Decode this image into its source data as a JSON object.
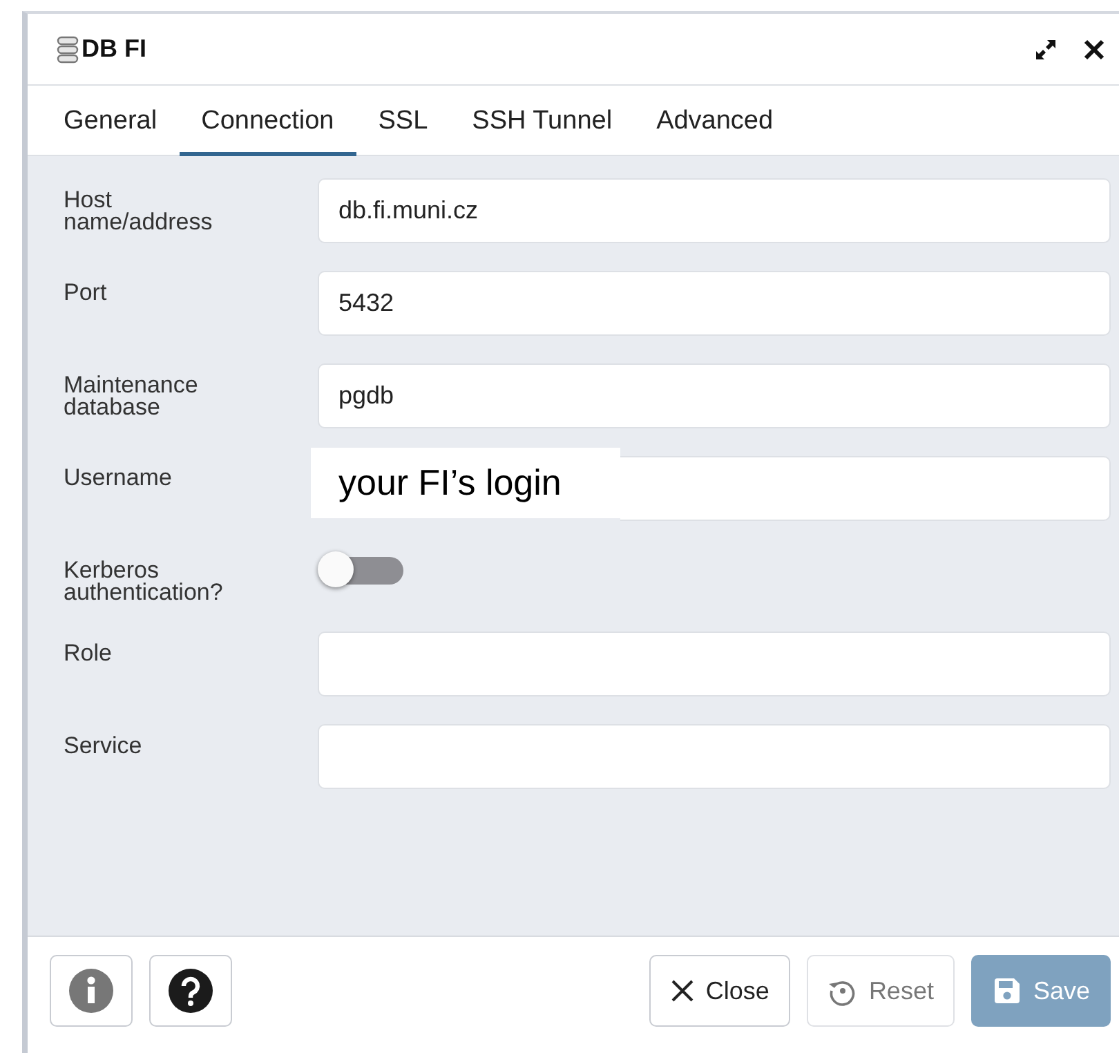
{
  "window": {
    "title": "DB FI"
  },
  "tabs": [
    {
      "label": "General",
      "selected": false
    },
    {
      "label": "Connection",
      "selected": true
    },
    {
      "label": "SSL",
      "selected": false
    },
    {
      "label": "SSH Tunnel",
      "selected": false
    },
    {
      "label": "Advanced",
      "selected": false
    }
  ],
  "fields": [
    {
      "kind": "text",
      "label": "Host name/address",
      "value": "db.fi.muni.cz"
    },
    {
      "kind": "text",
      "label": "Port",
      "value": "5432"
    },
    {
      "kind": "text",
      "label": "Maintenance database",
      "value": "pgdb"
    },
    {
      "kind": "note",
      "label": "Username",
      "value": "your FI’s login"
    },
    {
      "kind": "switch",
      "label": "Kerberos authentication?",
      "on": false
    },
    {
      "kind": "text",
      "label": "Role"
    },
    {
      "kind": "text",
      "label": "Service"
    }
  ],
  "footer": {
    "buttons": [
      {
        "kind": "info"
      },
      {
        "kind": "help"
      },
      {
        "kind": "close",
        "label": "Close",
        "disabled": false
      },
      {
        "kind": "reset",
        "label": "Reset",
        "disabled": true
      },
      {
        "kind": "save",
        "label": "Save",
        "disabled": true
      }
    ]
  }
}
